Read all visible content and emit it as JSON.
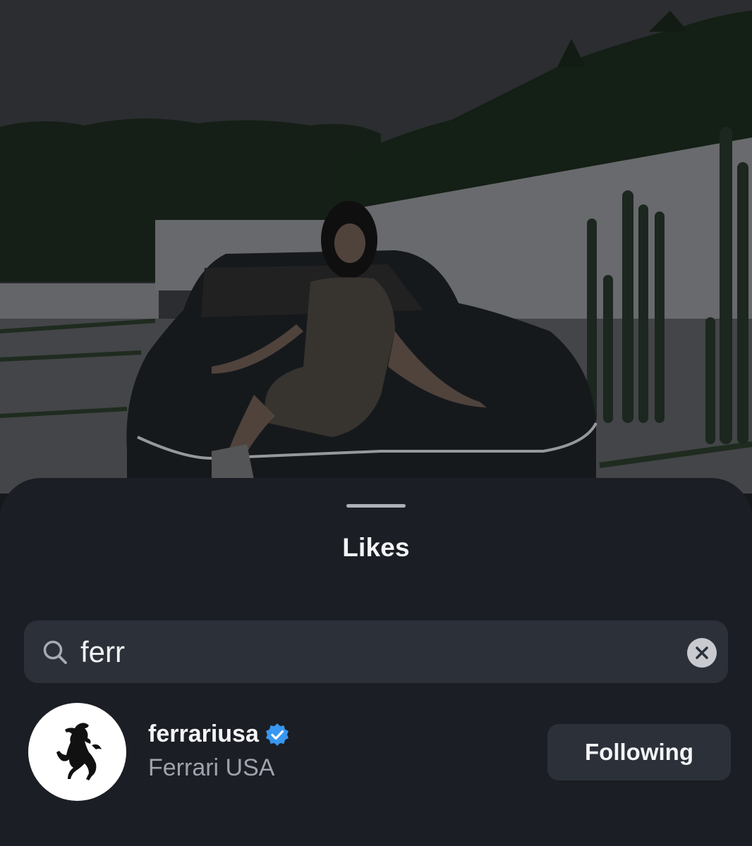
{
  "sheet": {
    "title": "Likes"
  },
  "search": {
    "value": "ferr",
    "icon": "search-icon",
    "clear_icon": "clear-icon"
  },
  "results": [
    {
      "username": "ferrariusa",
      "full_name": "Ferrari USA",
      "verified": true,
      "button_label": "Following",
      "avatar_icon": "prancing-horse-logo"
    }
  ],
  "colors": {
    "sheet_bg": "#1b1e24",
    "field_bg": "#2c3039",
    "verified_blue": "#3897f0",
    "secondary_text": "#9ea3ad"
  }
}
